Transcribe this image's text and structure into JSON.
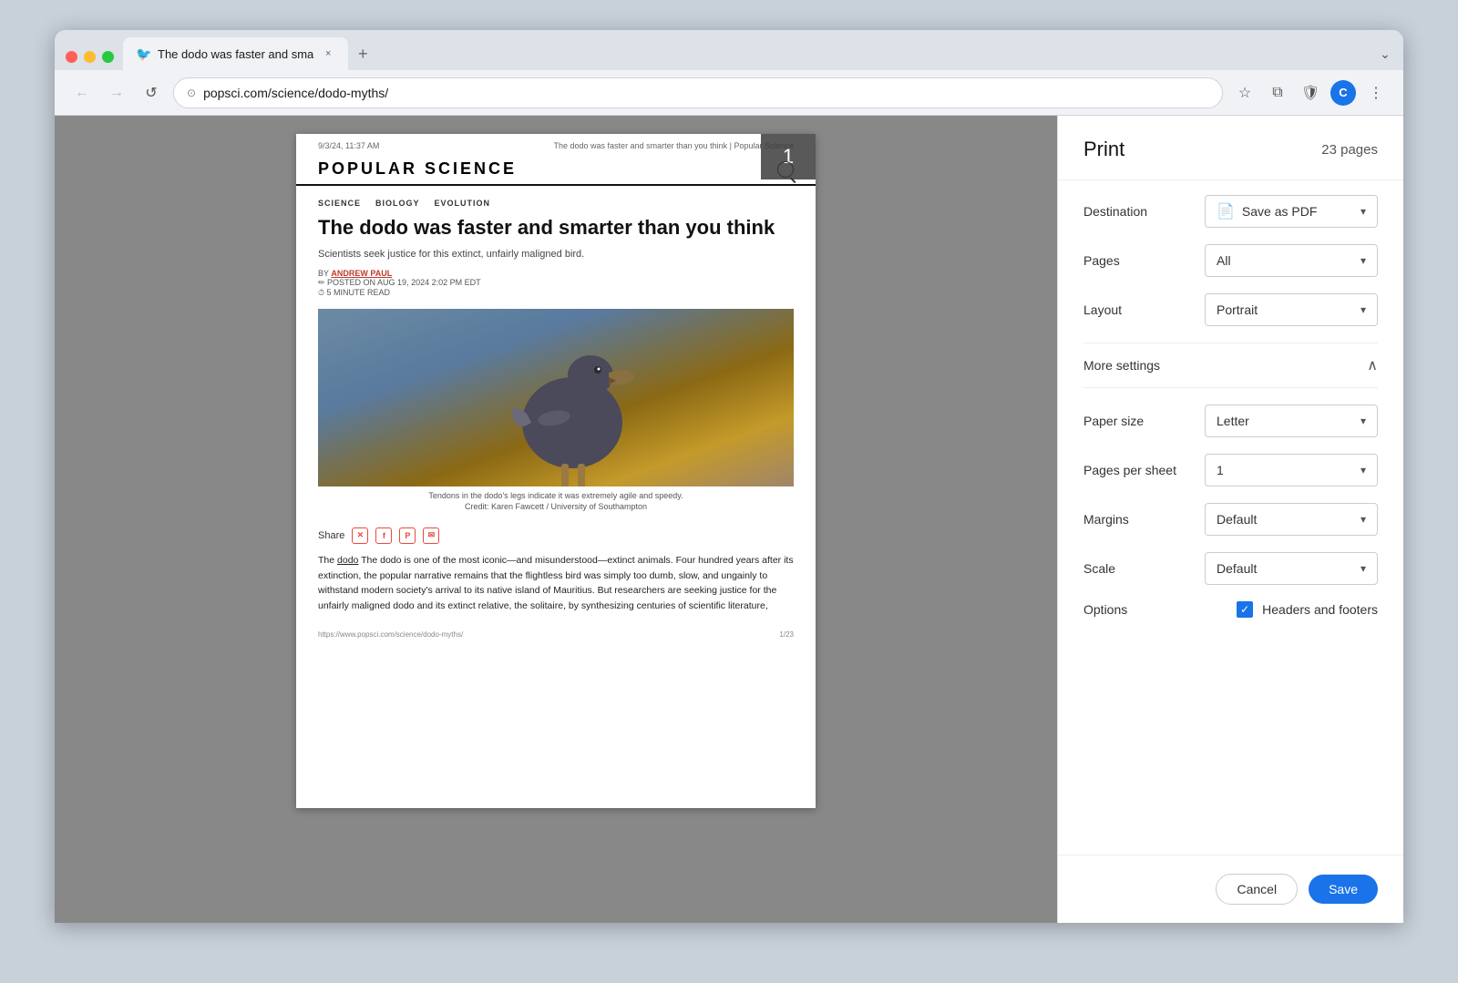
{
  "browser": {
    "tab": {
      "favicon": "🐦",
      "title": "The dodo was faster and sma",
      "close_label": "×"
    },
    "new_tab_label": "+",
    "chevron_label": "⌄",
    "nav": {
      "back_label": "←",
      "forward_label": "→",
      "reload_label": "↺"
    },
    "url_bar": {
      "icon_label": "⊙",
      "url": "popsci.com/science/dodo-myths/"
    },
    "actions": {
      "star_label": "☆",
      "extensions_label": "⧉",
      "shield_label": "🛡",
      "profile_label": "C",
      "menu_label": "⋮"
    }
  },
  "article": {
    "header_date": "9/3/24, 11:37 AM",
    "header_title": "The dodo was faster and smarter than you think | Popular Science",
    "site_name": "POPULAR SCIENCE",
    "categories": [
      "SCIENCE",
      "BIOLOGY",
      "EVOLUTION"
    ],
    "title": "The dodo was faster and smarter than you think",
    "subtitle": "Scientists seek justice for this extinct, unfairly maligned bird.",
    "by_label": "BY",
    "author": "ANDREW PAUL",
    "posted_label": "✏ POSTED ON AUG 19, 2024 2:02 PM EDT",
    "read_label": "⏱ 5 MINUTE READ",
    "image_caption_line1": "Tendons in the dodo's legs indicate it was extremely agile and speedy.",
    "image_caption_line2": "Credit: Karen Fawcett / University of Southampton",
    "share_label": "Share",
    "body_p1": "The dodo is one of the most iconic—and misunderstood—extinct animals. Four hundred years after its extinction, the popular narrative remains that the flightless bird was simply too dumb, slow, and ungainly to withstand modern society's arrival to its native island of Mauritius. But researchers are seeking justice for the unfairly maligned dodo and its extinct relative, the solitaire, by synthesizing centuries of scientific literature,",
    "page_num": "1",
    "footer_url": "https://www.popsci.com/science/dodo-myths/",
    "footer_page": "1/23"
  },
  "print_panel": {
    "title": "Print",
    "pages_label": "23 pages",
    "destination_label": "Destination",
    "destination_value": "Save as PDF",
    "pages_label2": "Pages",
    "pages_value": "All",
    "layout_label": "Layout",
    "layout_value": "Portrait",
    "more_settings_label": "More settings",
    "paper_size_label": "Paper size",
    "paper_size_value": "Letter",
    "pages_per_sheet_label": "Pages per sheet",
    "pages_per_sheet_value": "1",
    "margins_label": "Margins",
    "margins_value": "Default",
    "scale_label": "Scale",
    "scale_value": "Default",
    "options_label": "Options",
    "headers_footers_label": "Headers and footers",
    "cancel_label": "Cancel",
    "save_label": "Save"
  }
}
